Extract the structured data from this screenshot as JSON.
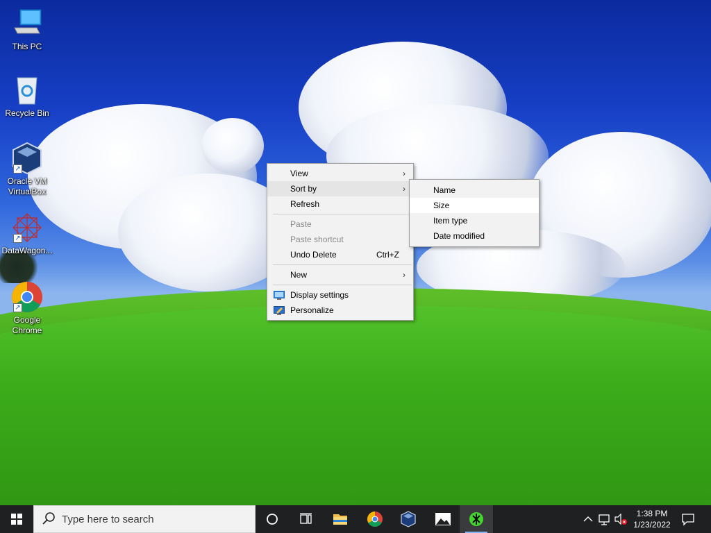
{
  "desktop": {
    "icons": [
      {
        "label": "This PC",
        "icon": "this-pc-icon"
      },
      {
        "label": "Recycle Bin",
        "icon": "recycle-bin-icon"
      },
      {
        "label": "Oracle VM VirtualBox",
        "icon": "virtualbox-icon"
      },
      {
        "label": "DataWagon...",
        "icon": "datawagon-icon"
      },
      {
        "label": "Google Chrome",
        "icon": "chrome-icon"
      }
    ]
  },
  "context_menu": {
    "view": "View",
    "sort_by": "Sort by",
    "refresh": "Refresh",
    "paste": "Paste",
    "paste_shortcut": "Paste shortcut",
    "undo_delete": "Undo Delete",
    "undo_delete_accel": "Ctrl+Z",
    "new": "New",
    "display_settings": "Display settings",
    "personalize": "Personalize",
    "arrow": "›"
  },
  "sort_submenu": {
    "name": "Name",
    "size": "Size",
    "item_type": "Item type",
    "date_modified": "Date modified"
  },
  "taskbar": {
    "search_placeholder": "Type here to search",
    "pinned": [
      "cortana-icon",
      "task-view-icon",
      "file-explorer-icon",
      "chrome-icon",
      "virtualbox-icon",
      "photos-icon",
      "razer-icon"
    ],
    "clock_time": "1:38 PM",
    "clock_date": "1/23/2022"
  },
  "colors": {
    "taskbar": "#1f2022",
    "menu_bg": "#f2f2f2",
    "accent": "#86b4f0"
  }
}
